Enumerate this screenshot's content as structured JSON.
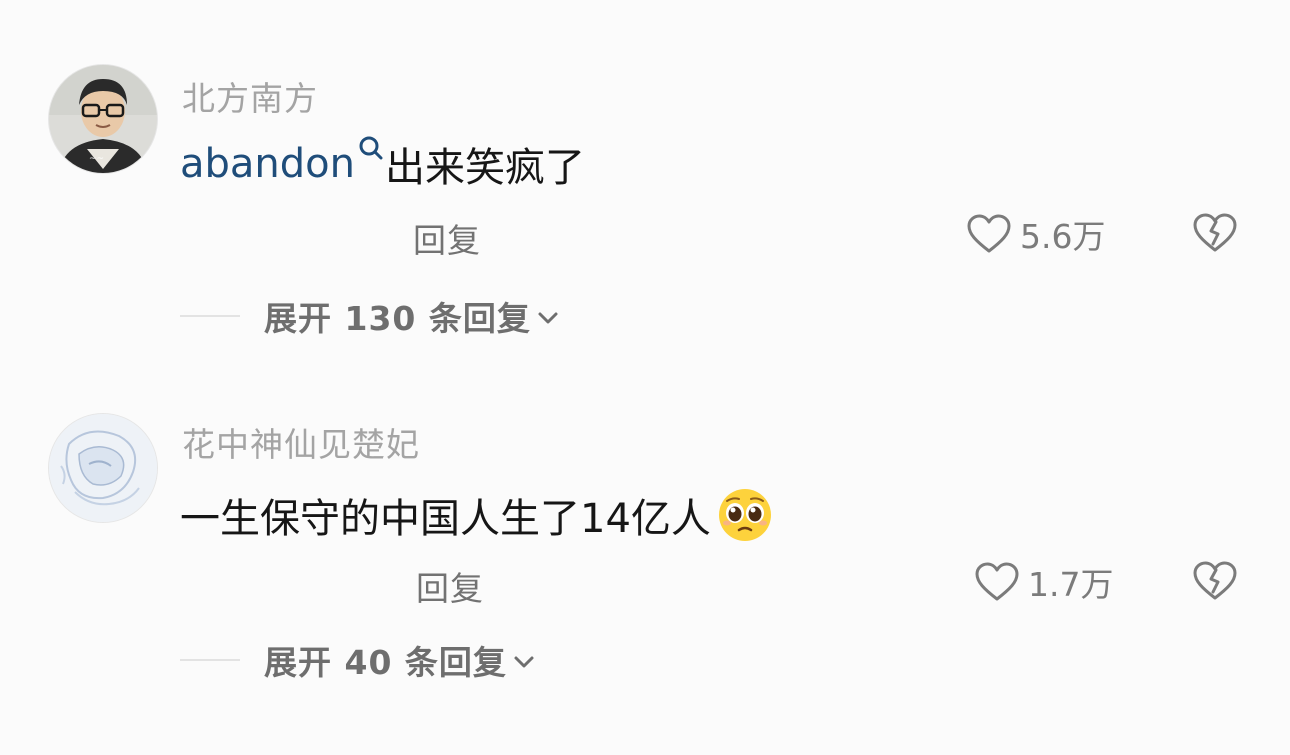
{
  "comments": [
    {
      "username": "北方南方",
      "mention": "abandon",
      "text": "出来笑疯了",
      "reply_label": "回复",
      "likes": "5.6万",
      "expand_label": "展开 130 条回复",
      "avatar_icon": "avatar-person-glasses"
    },
    {
      "username": "花中神仙见楚妃",
      "text": "一生保守的中国人生了14亿人",
      "emoji": "pleading-face-emoji",
      "reply_label": "回复",
      "likes": "1.7万",
      "expand_label": "展开 40 条回复",
      "avatar_icon": "avatar-blue-sketch"
    }
  ],
  "icons": {
    "like": "heart-outline-icon",
    "dislike": "broken-heart-icon",
    "expand": "chevron-down-icon",
    "mention": "search-icon"
  },
  "colors": {
    "background": "#fbfbfb",
    "username": "#a4a4a4",
    "mention": "#1f4d7a",
    "text": "#161616",
    "secondary": "#727272"
  }
}
